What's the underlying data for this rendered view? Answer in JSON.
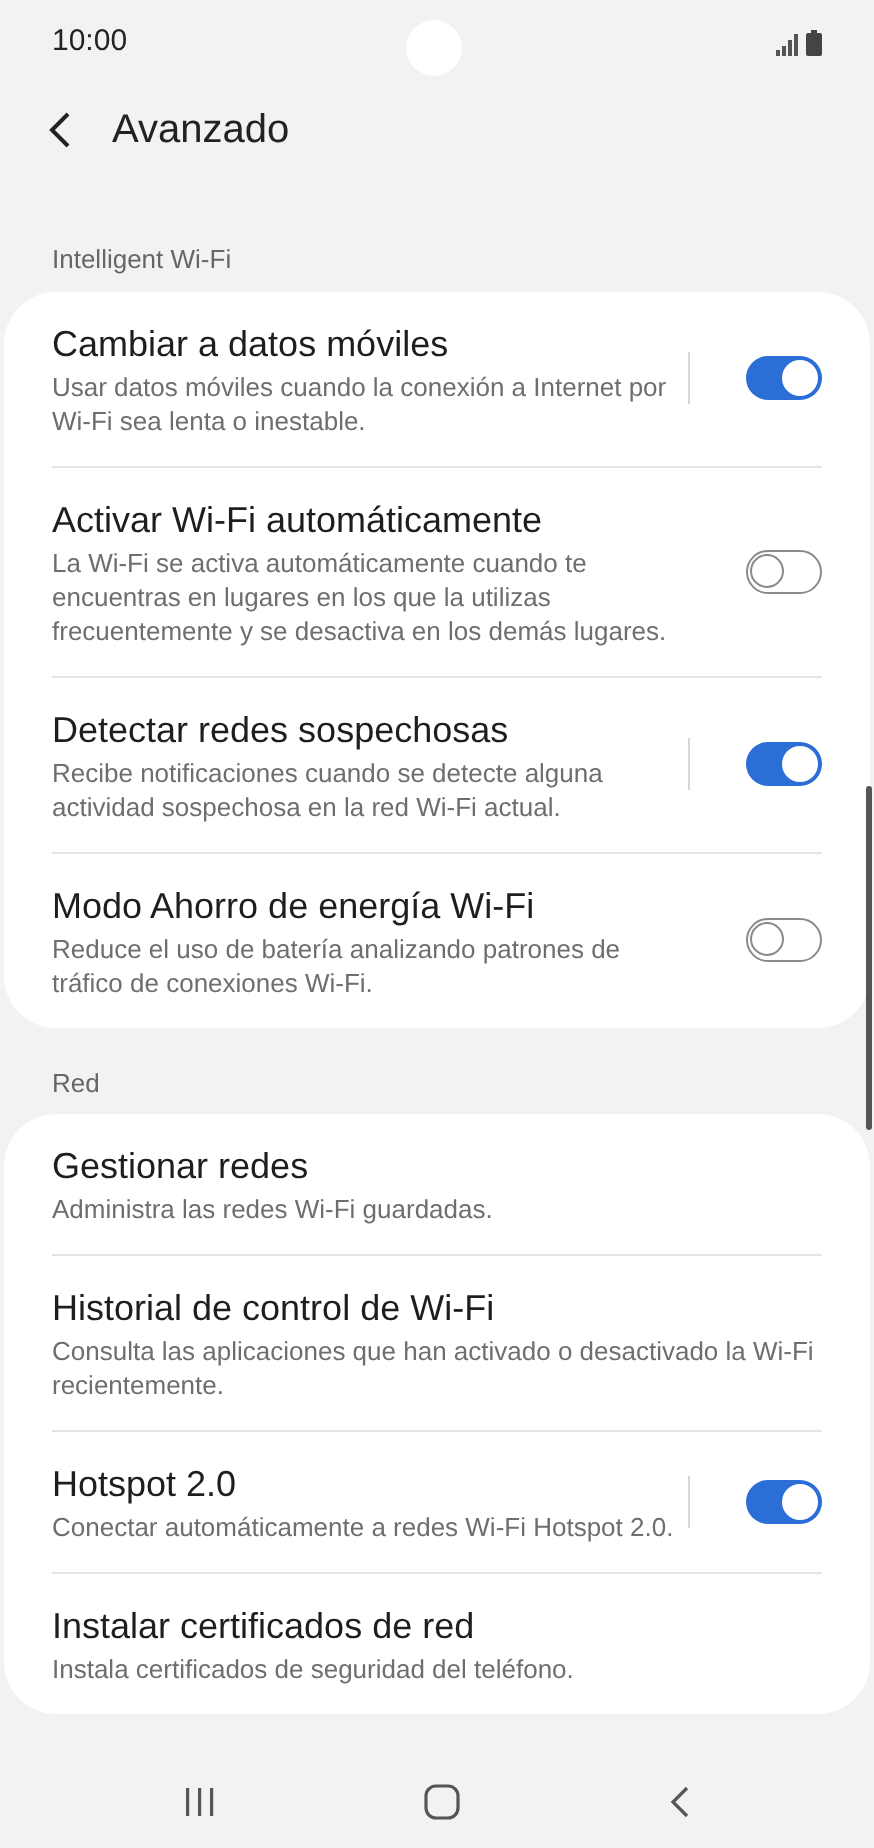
{
  "status_bar": {
    "time": "10:00"
  },
  "header": {
    "title": "Avanzado"
  },
  "sections": [
    {
      "label": "Intelligent Wi-Fi",
      "items": [
        {
          "title": "Cambiar a datos móviles",
          "description": "Usar datos móviles cuando la conexión a Internet por Wi-Fi sea lenta o inestable.",
          "kind": "switch",
          "on": true,
          "divider": true
        },
        {
          "title": "Activar Wi-Fi automáticamente",
          "description": "La Wi-Fi se activa automáticamente cuando te encuentras en lugares en los que la utilizas frecuentemente y se desactiva en los demás lugares.",
          "kind": "switch",
          "on": false,
          "divider": false
        },
        {
          "title": "Detectar redes sospechosas",
          "description": "Recibe notificaciones cuando se detecte alguna actividad sospechosa en la red Wi-Fi actual.",
          "kind": "switch",
          "on": true,
          "divider": true
        },
        {
          "title": "Modo Ahorro de energía Wi-Fi",
          "description": "Reduce el uso de batería analizando patrones de tráfico de conexiones Wi-Fi.",
          "kind": "switch",
          "on": false,
          "divider": false
        }
      ]
    },
    {
      "label": "Red",
      "items": [
        {
          "title": "Gestionar redes",
          "description": "Administra las redes Wi-Fi guardadas.",
          "kind": "link"
        },
        {
          "title": "Historial de control de Wi-Fi",
          "description": "Consulta las aplicaciones que han activado o desactivado la Wi-Fi recientemente.",
          "kind": "link"
        },
        {
          "title": "Hotspot 2.0",
          "description": "Conectar automáticamente a redes Wi-Fi Hotspot 2.0.",
          "kind": "switch",
          "on": true,
          "divider": true
        },
        {
          "title": "Instalar certificados de red",
          "description": "Instala certificados de seguridad del teléfono.",
          "kind": "link"
        }
      ]
    }
  ]
}
